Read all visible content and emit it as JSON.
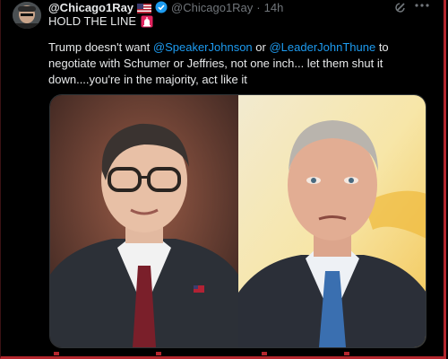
{
  "tweet": {
    "display_name": "@Chicago1Ray",
    "handle": "@Chicago1Ray",
    "separator": "·",
    "time": "14h",
    "first_line": "HOLD THE LINE",
    "text_parts": [
      "Trump doesn't want ",
      "@SpeakerJohnson",
      " or ",
      "@LeaderJohnThune",
      " to negotiate with Schumer or Jeffries, not one inch... let them shut it down....you're in the majority, act like it"
    ]
  },
  "icons": {
    "avatar": "avatar-photo",
    "flag": "us-flag-icon",
    "verified": "verified-badge-icon",
    "grok": "grok-icon",
    "more": "more-options-icon",
    "siren": "siren-emoji-icon"
  },
  "colors": {
    "background": "#000000",
    "text": "#e7e9ea",
    "muted": "#71767b",
    "link": "#1d9bf0",
    "frame": "#b3262d"
  }
}
